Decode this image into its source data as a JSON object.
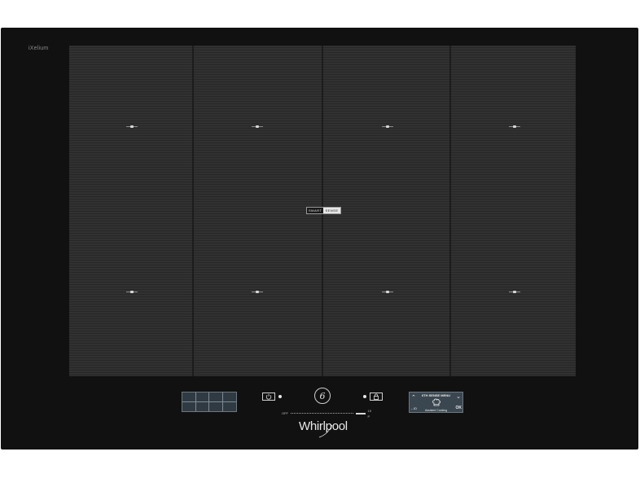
{
  "product": {
    "series_logo": "iXelium",
    "brand": "Whirlpool"
  },
  "cooking_surface": {
    "columns": 4,
    "rows": 2,
    "center_badge": {
      "left": "SMART",
      "right": "SENSE"
    }
  },
  "controls": {
    "zone_selector": {
      "columns": 4,
      "rows": 2
    },
    "power_button": {
      "icon": "power-icon"
    },
    "sixth_sense_button": {
      "label": "6",
      "icon": "sixth-sense-icon"
    },
    "lock_button": {
      "icon": "lock-icon"
    },
    "power_slider": {
      "min_label": "OFF",
      "max_label": "15 P"
    },
    "menu_display": {
      "title": "6TH SENSE MENU",
      "subtitle": "Assisted Cooking",
      "back_label": "←ID",
      "ok_label": "OK",
      "up_icon": "chevron-up-icon",
      "down_icon": "chevron-down-icon",
      "center_icon": "chef-hat-icon"
    }
  },
  "colors": {
    "frame": "#111111",
    "surface": "#2e2e2e",
    "display": "#3b4750",
    "text": "#e6e6e6"
  }
}
